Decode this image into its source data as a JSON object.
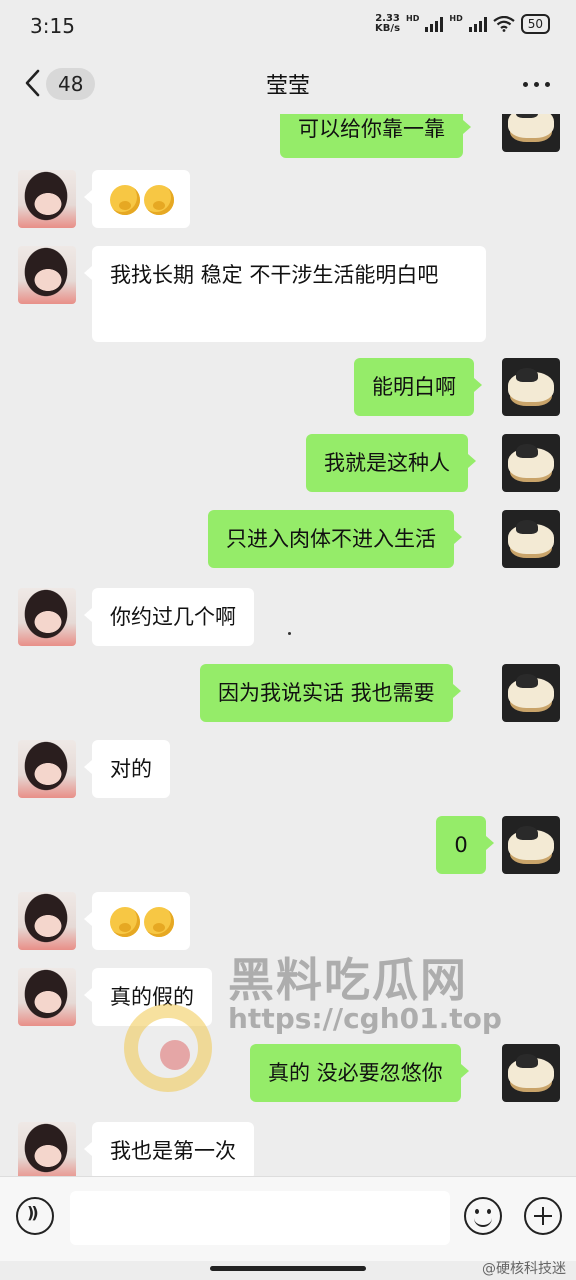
{
  "status_bar": {
    "time": "3:15",
    "net_speed_value": "2.33",
    "net_speed_unit": "KB/s",
    "hd1": "HD",
    "hd2": "HD",
    "battery": "50"
  },
  "header": {
    "unread_count": "48",
    "contact_name": "莹莹"
  },
  "messages": [
    {
      "side": "right",
      "text": "可以给你靠一靠"
    },
    {
      "side": "left",
      "text": "",
      "emoji": [
        "face-with-hand-over-mouth-emoji",
        "face-with-hand-over-mouth-emoji"
      ]
    },
    {
      "side": "left",
      "text": "我找长期 稳定 不干涉生活能明白吧"
    },
    {
      "side": "right",
      "text": "能明白啊"
    },
    {
      "side": "right",
      "text": "我就是这种人"
    },
    {
      "side": "right",
      "text": "只进入肉体不进入生活"
    },
    {
      "side": "left",
      "text": "你约过几个啊"
    },
    {
      "side": "right",
      "text": "因为我说实话 我也需要"
    },
    {
      "side": "left",
      "text": "对的"
    },
    {
      "side": "right",
      "text": "0"
    },
    {
      "side": "left",
      "text": "",
      "emoji": [
        "face-with-hand-over-mouth-emoji",
        "face-with-hand-over-mouth-emoji"
      ]
    },
    {
      "side": "left",
      "text": "真的假的"
    },
    {
      "side": "right",
      "text": "真的 没必要忽悠你"
    },
    {
      "side": "left",
      "text": "我也是第一次"
    }
  ],
  "watermark": {
    "title": "黑料吃瓜网",
    "url": "https://cgh01.top"
  },
  "footer": {
    "credit": "@硬核科技迷"
  },
  "colors": {
    "background": "#ededed",
    "sent_bubble": "#95ec69",
    "received_bubble": "#ffffff"
  }
}
